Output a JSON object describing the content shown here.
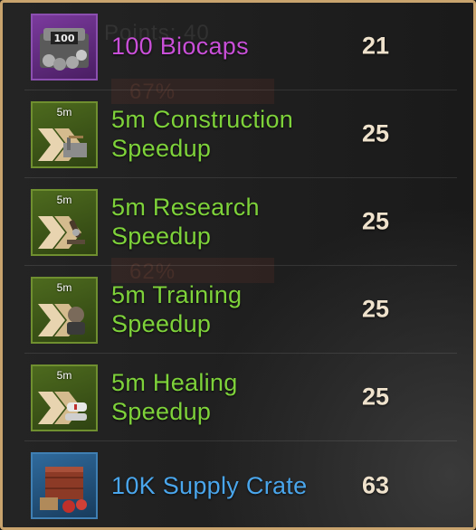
{
  "rewards": [
    {
      "name": "100 Biocaps",
      "points": "21",
      "badge": "",
      "rarity": "purple",
      "icon": "biocaps-icon"
    },
    {
      "name": "5m Construction Speedup",
      "points": "25",
      "badge": "5m",
      "rarity": "green",
      "icon": "construction-speedup-icon"
    },
    {
      "name": "5m Research Speedup",
      "points": "25",
      "badge": "5m",
      "rarity": "green",
      "icon": "research-speedup-icon"
    },
    {
      "name": "5m Training Speedup",
      "points": "25",
      "badge": "5m",
      "rarity": "green",
      "icon": "training-speedup-icon"
    },
    {
      "name": "5m Healing Speedup",
      "points": "25",
      "badge": "5m",
      "rarity": "green",
      "icon": "healing-speedup-icon"
    },
    {
      "name": "10K Supply Crate",
      "points": "63",
      "badge": "",
      "rarity": "blue",
      "icon": "supply-crate-icon"
    }
  ],
  "colors": {
    "frame": "#c9a46e",
    "green": "#7ed23a",
    "purple": "#c94fd8",
    "blue": "#4aa6ec",
    "points": "#efe2cc"
  }
}
